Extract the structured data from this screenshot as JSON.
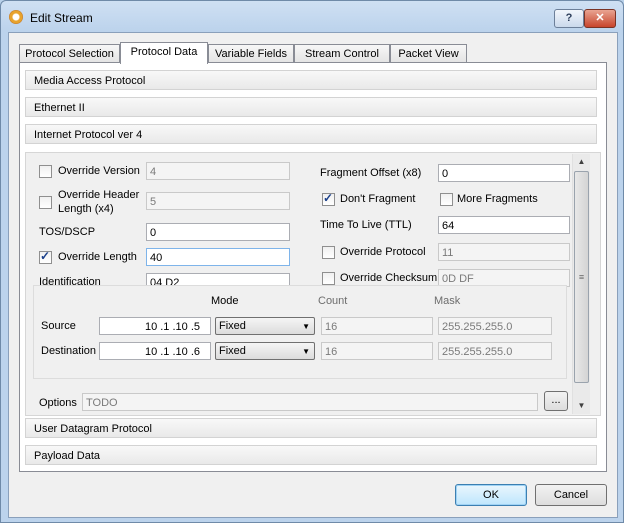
{
  "window": {
    "title": "Edit Stream"
  },
  "titlebar": {
    "help_label": "?",
    "close_label": "✕"
  },
  "tabs": [
    {
      "label": "Protocol Selection"
    },
    {
      "label": "Protocol Data"
    },
    {
      "label": "Variable Fields"
    },
    {
      "label": "Stream Control"
    },
    {
      "label": "Packet View"
    }
  ],
  "sections": {
    "mac": "Media Access Protocol",
    "eth": "Ethernet II",
    "ipv4": "Internet Protocol ver 4",
    "udp": "User Datagram Protocol",
    "payload": "Payload Data"
  },
  "ip": {
    "override_version_label": "Override Version",
    "version_value": "4",
    "override_header_label1": "Override Header",
    "override_header_label2": "Length (x4)",
    "header_value": "5",
    "tos_label": "TOS/DSCP",
    "tos_value": "0",
    "override_length_label": "Override Length",
    "length_value": "40",
    "identification_label": "Identification",
    "identification_value": "04 D2",
    "frag_offset_label": "Fragment Offset (x8)",
    "frag_offset_value": "0",
    "dont_fragment_label": "Don't Fragment",
    "more_fragments_label": "More Fragments",
    "ttl_label": "Time To Live (TTL)",
    "ttl_value": "64",
    "override_protocol_label": "Override Protocol",
    "protocol_value": "11",
    "override_checksum_label": "Override Checksum",
    "checksum_value": "0D DF",
    "override_version_checked": false,
    "override_header_checked": false,
    "override_length_checked": true,
    "dont_fragment_checked": true,
    "more_fragments_checked": false,
    "override_protocol_checked": false,
    "override_checksum_checked": false
  },
  "addr": {
    "mode_header": "Mode",
    "count_header": "Count",
    "mask_header": "Mask",
    "source_label": "Source",
    "source_ip": "10 .1 .10 .5",
    "source_mode": "Fixed",
    "source_count": "16",
    "source_mask": "255.255.255.0",
    "dest_label": "Destination",
    "dest_ip": "10 .1 .10 .6",
    "dest_mode": "Fixed",
    "dest_count": "16",
    "dest_mask": "255.255.255.0"
  },
  "options": {
    "label": "Options",
    "value": "TODO",
    "button": "..."
  },
  "buttons": {
    "ok": "OK",
    "cancel": "Cancel"
  },
  "icons": {
    "app": "gear-icon",
    "check": "checkmark-icon",
    "dropdown": "chevron-down-icon",
    "scroll_up": "arrow-up-icon",
    "scroll_down": "arrow-down-icon"
  }
}
